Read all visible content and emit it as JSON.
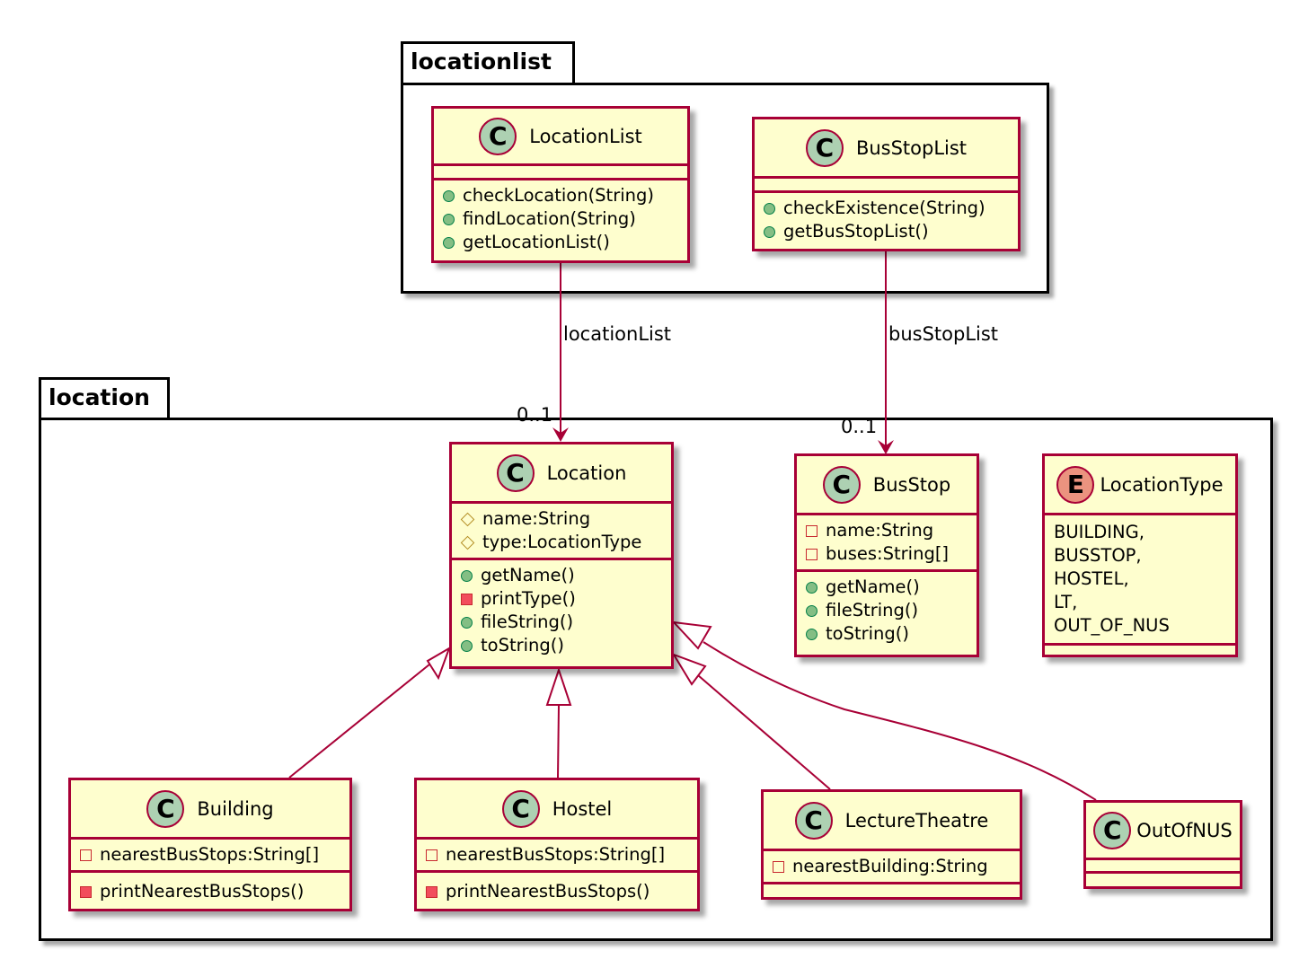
{
  "packages": {
    "locationlist": {
      "name": "locationlist"
    },
    "location": {
      "name": "location"
    }
  },
  "classes": {
    "LocationList": {
      "name": "LocationList",
      "stereotype": "C",
      "fields": [],
      "methods": [
        {
          "vis": "public",
          "text": "checkLocation(String)"
        },
        {
          "vis": "public",
          "text": "findLocation(String)"
        },
        {
          "vis": "public",
          "text": "getLocationList()"
        }
      ]
    },
    "BusStopList": {
      "name": "BusStopList",
      "stereotype": "C",
      "fields": [],
      "methods": [
        {
          "vis": "public",
          "text": "checkExistence(String)"
        },
        {
          "vis": "public",
          "text": "getBusStopList()"
        }
      ]
    },
    "Location": {
      "name": "Location",
      "stereotype": "C",
      "fields": [
        {
          "vis": "protected",
          "text": "name:String"
        },
        {
          "vis": "protected",
          "text": "type:LocationType"
        }
      ],
      "methods": [
        {
          "vis": "public",
          "text": "getName()"
        },
        {
          "vis": "private",
          "text": "printType()"
        },
        {
          "vis": "public",
          "text": "fileString()"
        },
        {
          "vis": "public",
          "text": "toString()"
        }
      ]
    },
    "BusStop": {
      "name": "BusStop",
      "stereotype": "C",
      "fields": [
        {
          "vis": "private",
          "text": "name:String"
        },
        {
          "vis": "private",
          "text": "buses:String[]"
        }
      ],
      "methods": [
        {
          "vis": "public",
          "text": "getName()"
        },
        {
          "vis": "public",
          "text": "fileString()"
        },
        {
          "vis": "public",
          "text": "toString()"
        }
      ]
    },
    "LocationType": {
      "name": "LocationType",
      "stereotype": "E",
      "values": [
        "BUILDING,",
        "BUSSTOP,",
        "HOSTEL,",
        "LT,",
        "OUT_OF_NUS"
      ]
    },
    "Building": {
      "name": "Building",
      "stereotype": "C",
      "fields": [
        {
          "vis": "private",
          "text": "nearestBusStops:String[]"
        }
      ],
      "methods": [
        {
          "vis": "private",
          "text": "printNearestBusStops()"
        }
      ]
    },
    "Hostel": {
      "name": "Hostel",
      "stereotype": "C",
      "fields": [
        {
          "vis": "private",
          "text": "nearestBusStops:String[]"
        }
      ],
      "methods": [
        {
          "vis": "private",
          "text": "printNearestBusStops()"
        }
      ]
    },
    "LectureTheatre": {
      "name": "LectureTheatre",
      "stereotype": "C",
      "fields": [
        {
          "vis": "private",
          "text": "nearestBuilding:String"
        }
      ],
      "methods": []
    },
    "OutOfNUS": {
      "name": "OutOfNUS",
      "stereotype": "C",
      "fields": [],
      "methods": []
    }
  },
  "relations": [
    {
      "type": "association",
      "from": "LocationList",
      "to": "Location",
      "label": "locationList",
      "multiplicity": "0..1"
    },
    {
      "type": "association",
      "from": "BusStopList",
      "to": "BusStop",
      "label": "busStopList",
      "multiplicity": "0..1"
    },
    {
      "type": "inheritance",
      "from": "Building",
      "to": "Location"
    },
    {
      "type": "inheritance",
      "from": "Hostel",
      "to": "Location"
    },
    {
      "type": "inheritance",
      "from": "LectureTheatre",
      "to": "Location"
    },
    {
      "type": "inheritance",
      "from": "OutOfNUS",
      "to": "Location"
    }
  ],
  "colors": {
    "class_fill": "#fefece",
    "class_border": "#a80036",
    "class_badge": "#add1b2",
    "enum_badge": "#eb937f",
    "public_icon": "#84be84",
    "private_icon": "#f24d5c",
    "protected_icon": "#b38d22",
    "edge": "#a80036"
  }
}
